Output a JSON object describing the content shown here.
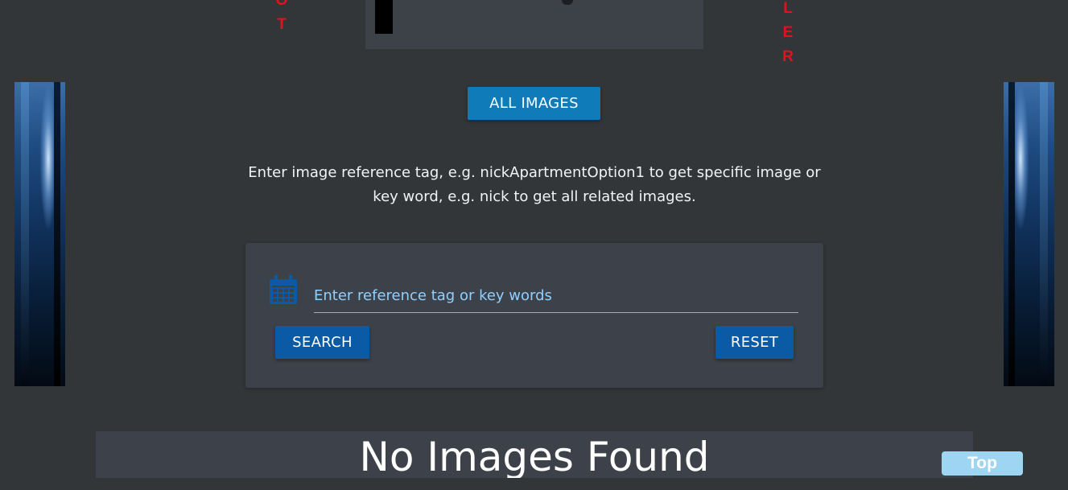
{
  "header": {
    "left_letters": [
      "O",
      "T"
    ],
    "right_letters": [
      "L",
      "E",
      "R"
    ]
  },
  "all_images_button": {
    "label": "ALL IMAGES"
  },
  "instructions": {
    "line1": "Enter image reference tag, e.g. nickApartmentOption1 to get specific image or",
    "line2": "key word, e.g. nick to get all related images."
  },
  "search": {
    "placeholder": "Enter reference tag or key words",
    "value": "",
    "search_label": "SEARCH",
    "reset_label": "RESET",
    "icon": "calendar-icon"
  },
  "results": {
    "message": "No Images Found"
  },
  "top_button": {
    "label": "Top"
  },
  "colors": {
    "background": "#333639",
    "card": "#3d4149",
    "all_images_button": "#0f7bb8",
    "action_button": "#0a5aa6",
    "input_text": "#8fd0ff",
    "top_button": "#9dd5f2",
    "accent_red": "#e0121b"
  }
}
